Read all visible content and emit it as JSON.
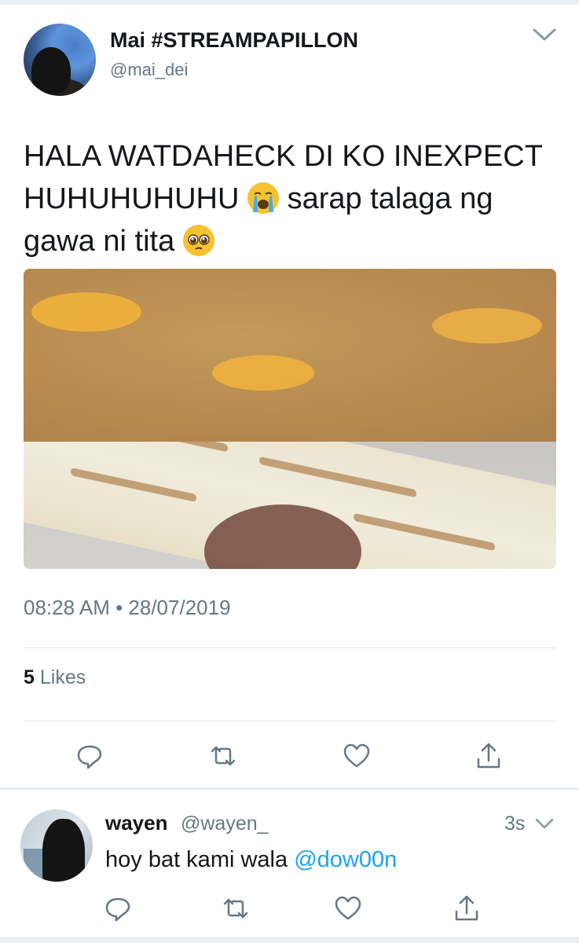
{
  "tweet": {
    "display_name": "Mai #STREAMPAPILLON",
    "handle": "@mai_dei",
    "text_part1": "HALA WATDAHECK DI KO INEXPECT HUHUHUHUHU",
    "text_part2": "sarap talaga ng gawa ni tita",
    "emoji1": "loudly-crying-face",
    "emoji2": "pleading-face",
    "timestamp": "08:28 AM • 28/07/2019",
    "likes_count": "5",
    "likes_label": "Likes"
  },
  "reply": {
    "display_name": "wayen",
    "handle": "@wayen_",
    "time": "3s",
    "text": "hoy bat kami wala",
    "mention": "@dow00n"
  },
  "icons": {
    "reply": "reply-icon",
    "retweet": "retweet-icon",
    "like": "heart-icon",
    "share": "share-icon",
    "menu": "chevron-down-icon"
  },
  "colors": {
    "text": "#14171a",
    "secondary": "#657786",
    "link": "#1da1f2",
    "border": "#e1e8ed"
  }
}
